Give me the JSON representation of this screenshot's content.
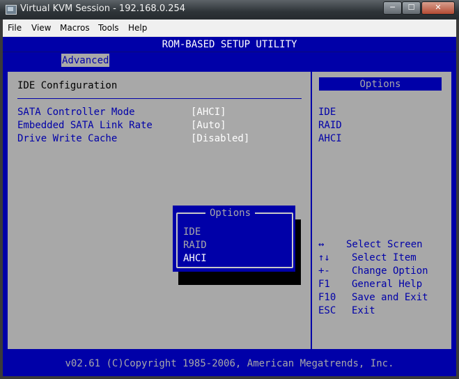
{
  "window": {
    "title": "Virtual KVM Session - 192.168.0.254",
    "min_label": "─",
    "max_label": "☐",
    "close_label": "✕"
  },
  "menubar": {
    "items": [
      "File",
      "View",
      "Macros",
      "Tools",
      "Help"
    ]
  },
  "bios": {
    "header": "ROM-BASED SETUP UTILITY",
    "active_tab": "Advanced",
    "section_title": "IDE Configuration",
    "settings": [
      {
        "label": "SATA Controller Mode",
        "value": "[AHCI]"
      },
      {
        "label": "Embedded SATA Link Rate",
        "value": "[Auto]"
      },
      {
        "label": "Drive Write Cache",
        "value": "[Disabled]"
      }
    ],
    "help": {
      "title": "Options",
      "options": [
        "IDE",
        "RAID",
        "AHCI"
      ],
      "keys": [
        {
          "key": "↔",
          "desc": "Select Screen"
        },
        {
          "key": "↑↓",
          "desc": "Select Item"
        },
        {
          "key": "+-",
          "desc": "Change Option"
        },
        {
          "key": "F1",
          "desc": "General Help"
        },
        {
          "key": "F10",
          "desc": "Save and Exit"
        },
        {
          "key": "ESC",
          "desc": "Exit"
        }
      ]
    },
    "popup": {
      "title": "Options",
      "options": [
        "IDE",
        "RAID",
        "AHCI"
      ],
      "selected": "AHCI"
    },
    "footer": "v02.61 (C)Copyright 1985-2006, American Megatrends, Inc."
  },
  "colors": {
    "bios_blue": "#0000a8",
    "bios_gray": "#a8a8a8",
    "highlight_white": "#ffffff"
  }
}
